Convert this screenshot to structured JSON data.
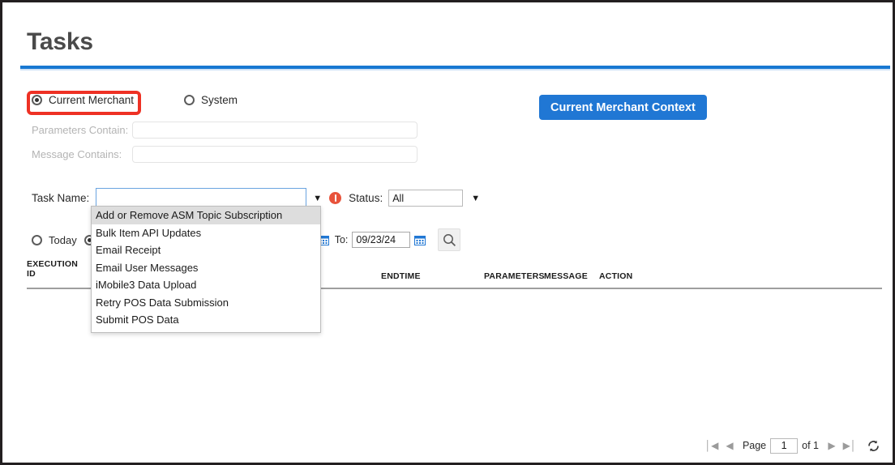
{
  "page": {
    "title": "Tasks"
  },
  "scope": {
    "options": [
      {
        "label": "Current Merchant",
        "selected": true
      },
      {
        "label": "System",
        "selected": false
      }
    ],
    "context_button": "Current Merchant Context"
  },
  "filters": {
    "parameters_label": "Parameters Contain:",
    "parameters_value": "",
    "message_label": "Message Contains:",
    "message_value": "",
    "task_name_label": "Task Name:",
    "task_name_value": "",
    "status_label": "Status:",
    "status_value": "All"
  },
  "task_name_options": [
    {
      "label": "Add or Remove ASM Topic Subscription",
      "selected": true
    },
    {
      "label": "Bulk Item API Updates",
      "selected": false
    },
    {
      "label": "Email Receipt",
      "selected": false
    },
    {
      "label": "Email User Messages",
      "selected": false
    },
    {
      "label": "iMobile3 Data Upload",
      "selected": false
    },
    {
      "label": "Retry POS Data Submission",
      "selected": false
    },
    {
      "label": "Submit POS Data",
      "selected": false
    }
  ],
  "date_row": {
    "today_label": "Today",
    "today_selected": false,
    "range_selected": true,
    "to_label": "To:",
    "to_value": "09/23/24"
  },
  "table": {
    "headers": [
      "EXECUTION ID",
      "ENDTIME",
      "PARAMETERS",
      "MESSAGE",
      "ACTION"
    ],
    "rows": []
  },
  "pagination": {
    "first_icon": "first-page-icon",
    "prev_icon": "previous-page-icon",
    "page_label": "Page",
    "page_value": "1",
    "of_label": "of 1",
    "next_icon": "next-page-icon",
    "last_icon": "last-page-icon",
    "refresh_icon": "refresh-icon"
  },
  "colors": {
    "accent_blue": "#1878d2",
    "button_blue": "#2077d4",
    "annotation_red": "#ee3124",
    "warning_orange": "#e8533b",
    "title_gray": "#4a4a4a"
  }
}
